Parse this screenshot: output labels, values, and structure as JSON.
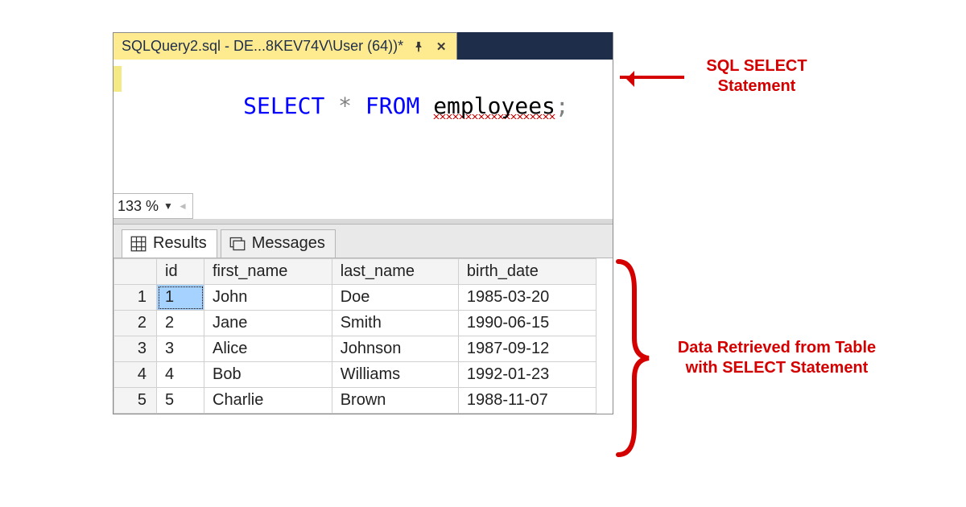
{
  "tab": {
    "title": "SQLQuery2.sql - DE...8KEV74V\\User (64))*"
  },
  "code": {
    "kw_select": "SELECT",
    "star": " * ",
    "kw_from": "FROM",
    "space": " ",
    "table": "employees",
    "semi": ";"
  },
  "zoom": {
    "value": "133 %"
  },
  "result_tabs": {
    "results": "Results",
    "messages": "Messages"
  },
  "columns": [
    "id",
    "first_name",
    "last_name",
    "birth_date"
  ],
  "rows": [
    {
      "n": "1",
      "id": "1",
      "first_name": "John",
      "last_name": "Doe",
      "birth_date": "1985-03-20"
    },
    {
      "n": "2",
      "id": "2",
      "first_name": "Jane",
      "last_name": "Smith",
      "birth_date": "1990-06-15"
    },
    {
      "n": "3",
      "id": "3",
      "first_name": "Alice",
      "last_name": "Johnson",
      "birth_date": "1987-09-12"
    },
    {
      "n": "4",
      "id": "4",
      "first_name": "Bob",
      "last_name": "Williams",
      "birth_date": "1992-01-23"
    },
    {
      "n": "5",
      "id": "5",
      "first_name": "Charlie",
      "last_name": "Brown",
      "birth_date": "1988-11-07"
    }
  ],
  "annotations": {
    "select_label_l1": "SQL SELECT",
    "select_label_l2": "Statement",
    "data_label_l1": "Data Retrieved from Table",
    "data_label_l2": "with SELECT Statement"
  }
}
